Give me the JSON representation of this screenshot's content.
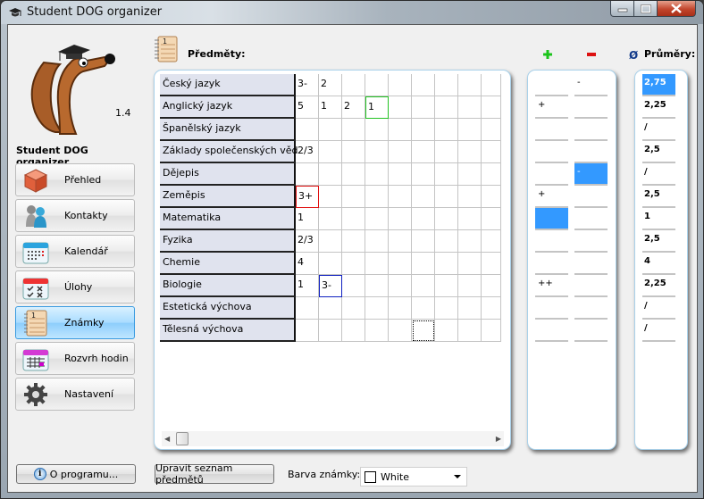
{
  "window": {
    "title": "Student DOG organizer"
  },
  "sidebar": {
    "version": "1.4",
    "app_name": "Student DOG organizer",
    "items": [
      {
        "label": "Přehled",
        "icon": "cube-icon",
        "active": false
      },
      {
        "label": "Kontakty",
        "icon": "contacts-icon",
        "active": false
      },
      {
        "label": "Kalendář",
        "icon": "calendar-icon",
        "active": false
      },
      {
        "label": "Úlohy",
        "icon": "tasks-icon",
        "active": false
      },
      {
        "label": "Známky",
        "icon": "notebook-icon",
        "active": true
      },
      {
        "label": "Rozvrh hodin",
        "icon": "timetable-icon",
        "active": false
      },
      {
        "label": "Nastavení",
        "icon": "gear-icon",
        "active": false
      }
    ],
    "about_label": "O programu..."
  },
  "main": {
    "subjects_title": "Předměty:",
    "averages_title": "Průměry:",
    "plus_symbol": "+",
    "minus_symbol": "−",
    "avg_symbol": "Ø",
    "grade_columns": 9,
    "rows": [
      {
        "subject": "Český jazyk",
        "grades": [
          "3-",
          "2",
          "",
          "",
          "",
          "",
          "",
          "",
          ""
        ],
        "plus": "",
        "minus": "-",
        "average": "2,75"
      },
      {
        "subject": "Anglický jazyk",
        "grades": [
          "5",
          "1",
          "2",
          "1",
          "",
          "",
          "",
          "",
          ""
        ],
        "plus": "+",
        "minus": "",
        "average": "2,25"
      },
      {
        "subject": "Španělský jazyk",
        "grades": [
          "",
          "",
          "",
          "",
          "",
          "",
          "",
          "",
          ""
        ],
        "plus": "",
        "minus": "",
        "average": "/"
      },
      {
        "subject": "Základy společenských věd",
        "grades": [
          "2/3",
          "",
          "",
          "",
          "",
          "",
          "",
          "",
          ""
        ],
        "plus": "",
        "minus": "",
        "average": "2,5"
      },
      {
        "subject": "Dějepis",
        "grades": [
          "",
          "",
          "",
          "",
          "",
          "",
          "",
          "",
          ""
        ],
        "plus": "",
        "minus": "-",
        "average": "/"
      },
      {
        "subject": "Zeměpis",
        "grades": [
          "3+",
          "",
          "",
          "",
          "",
          "",
          "",
          "",
          ""
        ],
        "plus": "+",
        "minus": "",
        "average": "2,5"
      },
      {
        "subject": "Matematika",
        "grades": [
          "1",
          "",
          "",
          "",
          "",
          "",
          "",
          "",
          ""
        ],
        "plus": "",
        "minus": "",
        "average": "1"
      },
      {
        "subject": "Fyzika",
        "grades": [
          "2/3",
          "",
          "",
          "",
          "",
          "",
          "",
          "",
          ""
        ],
        "plus": "",
        "minus": "",
        "average": "2,5"
      },
      {
        "subject": "Chemie",
        "grades": [
          "4",
          "",
          "",
          "",
          "",
          "",
          "",
          "",
          ""
        ],
        "plus": "",
        "minus": "",
        "average": "4"
      },
      {
        "subject": "Biologie",
        "grades": [
          "1",
          "3-",
          "",
          "",
          "",
          "",
          "",
          "",
          ""
        ],
        "plus": "++",
        "minus": "",
        "average": "2,25"
      },
      {
        "subject": "Estetická výchova",
        "grades": [
          "",
          "",
          "",
          "",
          "",
          "",
          "",
          "",
          ""
        ],
        "plus": "",
        "minus": "",
        "average": "/"
      },
      {
        "subject": "Tělesná výchova",
        "grades": [
          "",
          "",
          "",
          "",
          "",
          "",
          "",
          "",
          ""
        ],
        "plus": "",
        "minus": "",
        "average": "/"
      }
    ],
    "grade_highlights": [
      {
        "row": 1,
        "col": 3,
        "color": "#23c323"
      },
      {
        "row": 5,
        "col": 0,
        "color": "#e01010"
      },
      {
        "row": 9,
        "col": 1,
        "color": "#1020c0"
      }
    ],
    "focused_cell": {
      "row": 11,
      "col": 5
    },
    "selected": {
      "average_row": 0,
      "minus_row": 4,
      "plus_row": 6
    },
    "edit_subjects_label": "Upravit seznam předmětů",
    "grade_color_label": "Barva známky:",
    "grade_color_value": "White"
  },
  "colors": {
    "selection": "#3399ff",
    "active_nav": "#8ccdfc"
  }
}
